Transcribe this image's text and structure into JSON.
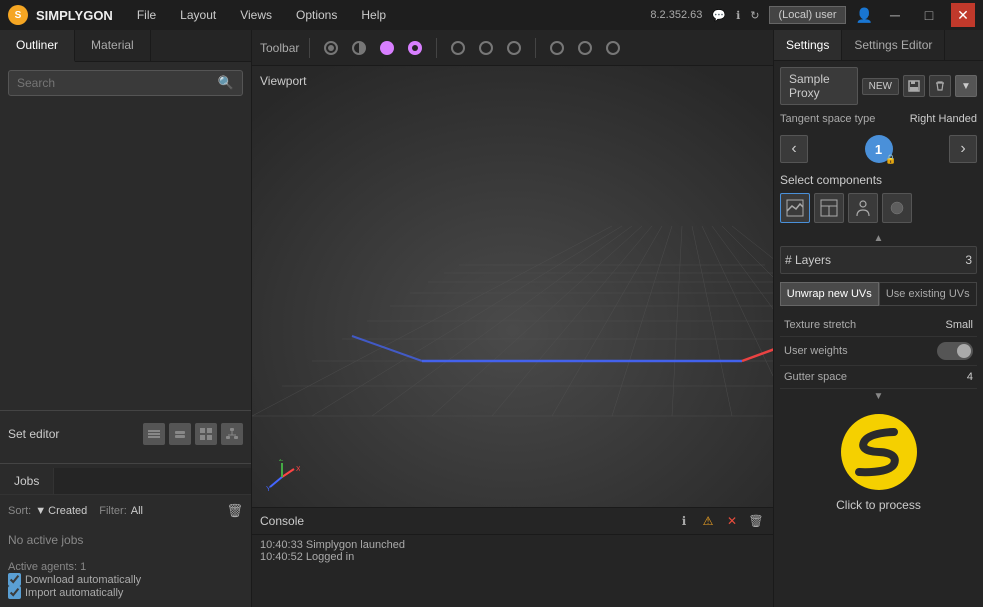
{
  "titlebar": {
    "app_name": "SIMPLYGON",
    "version": "8.2.352.63",
    "local_user": "(Local) user",
    "menu_items": [
      "File",
      "Layout",
      "Views",
      "Options",
      "Help"
    ],
    "win_min": "─",
    "win_max": "□",
    "win_close": "✕"
  },
  "left_panel": {
    "tabs": [
      "Outliner",
      "Material"
    ],
    "active_tab": "Outliner",
    "search": {
      "placeholder": "Search",
      "value": ""
    },
    "set_editor": {
      "label": "Set editor"
    },
    "jobs": {
      "tab_label": "Jobs",
      "sort_label": "Sort:",
      "sort_value": "Created",
      "filter_label": "Filter:",
      "filter_value": "All",
      "no_active_jobs": "No active jobs",
      "active_agents_label": "Active agents:",
      "active_agents_count": "1",
      "download_auto": "Download automatically",
      "import_auto": "Import automatically"
    }
  },
  "center_panel": {
    "toolbar_label": "Toolbar",
    "viewport_label": "Viewport",
    "console": {
      "label": "Console",
      "logs": [
        "10:40:33 Simplygon launched",
        "10:40:52 Logged in"
      ]
    }
  },
  "right_panel": {
    "settings_tabs": [
      "Settings",
      "Settings Editor"
    ],
    "active_settings_tab": "Settings",
    "proxy_name": "Sample Proxy",
    "proxy_new_label": "NEW",
    "tangent_space_label": "Tangent space type",
    "tangent_space_value": "Right Handed",
    "nav": {
      "prev": "‹",
      "next": "›",
      "step": "1"
    },
    "select_components_label": "Select components",
    "layers_label": "# Layers",
    "layers_value": "3",
    "uv_tabs": [
      "Unwrap new UVs",
      "Use existing UVs"
    ],
    "active_uv_tab": "Unwrap new UVs",
    "texture_stretch_label": "Texture stretch",
    "texture_stretch_value": "Small",
    "user_weights_label": "User weights",
    "gutter_space_label": "Gutter space",
    "gutter_space_value": "4",
    "click_to_process": "Click to process"
  }
}
